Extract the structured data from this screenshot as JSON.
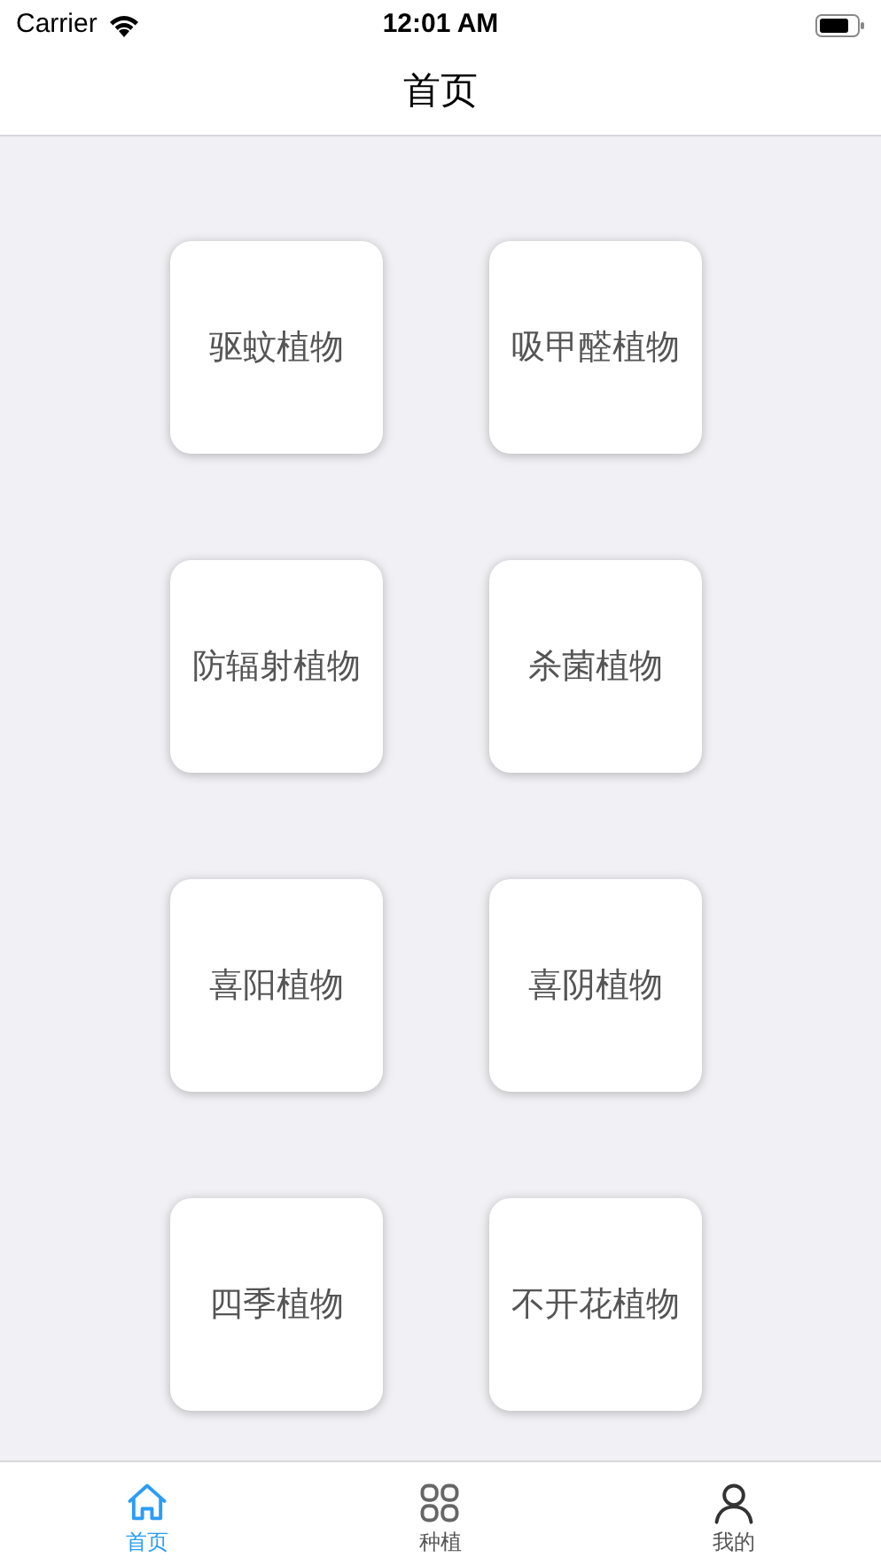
{
  "status_bar": {
    "carrier": "Carrier",
    "time": "12:01 AM"
  },
  "nav_bar": {
    "title": "首页"
  },
  "categories": [
    {
      "label": "驱蚊植物"
    },
    {
      "label": "吸甲醛植物"
    },
    {
      "label": "防辐射植物"
    },
    {
      "label": "杀菌植物"
    },
    {
      "label": "喜阳植物"
    },
    {
      "label": "喜阴植物"
    },
    {
      "label": "四季植物"
    },
    {
      "label": "不开花植物"
    }
  ],
  "tab_bar": [
    {
      "label": "首页",
      "kind": "home",
      "selected": true
    },
    {
      "label": "种植",
      "kind": "grid",
      "selected": false
    },
    {
      "label": "我的",
      "kind": "person",
      "selected": false
    }
  ]
}
